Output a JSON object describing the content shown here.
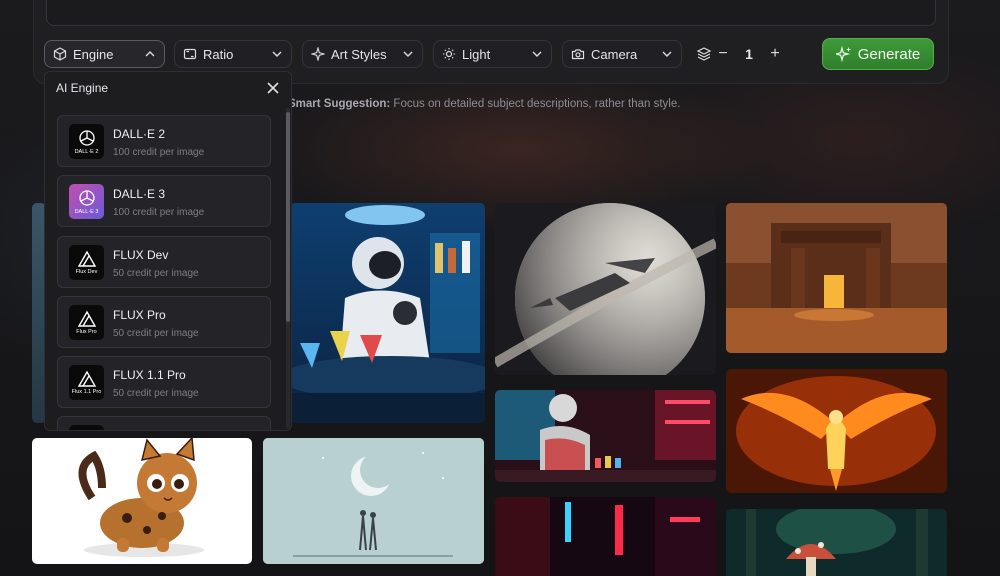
{
  "toolbar": {
    "engine_label": "Engine",
    "ratio_label": "Ratio",
    "art_styles_label": "Art Styles",
    "light_label": "Light",
    "camera_label": "Camera",
    "quantity": "1",
    "minus": "−",
    "plus": "+",
    "generate_label": "Generate"
  },
  "suggestion": {
    "prefix": "Smart Suggestion:",
    "text": " Focus on detailed subject descriptions, rather than style."
  },
  "engine_menu": {
    "title": "AI Engine",
    "items": [
      {
        "name": "DALL·E 2",
        "credit": "100 credit per image",
        "logo_tag": "DALL·E 2"
      },
      {
        "name": "DALL·E 3",
        "credit": "100 credit per image",
        "logo_tag": "DALL·E 3"
      },
      {
        "name": "FLUX Dev",
        "credit": "50 credit per image",
        "logo_tag": "Flux Dev"
      },
      {
        "name": "FLUX Pro",
        "credit": "50 credit per image",
        "logo_tag": "Flux Pro"
      },
      {
        "name": "FLUX 1.1 Pro",
        "credit": "50 credit per image",
        "logo_tag": "Flux 1.1 Pro"
      }
    ]
  },
  "colors": {
    "accent_green": "#3f9a3a",
    "panel": "#1d1d20"
  }
}
